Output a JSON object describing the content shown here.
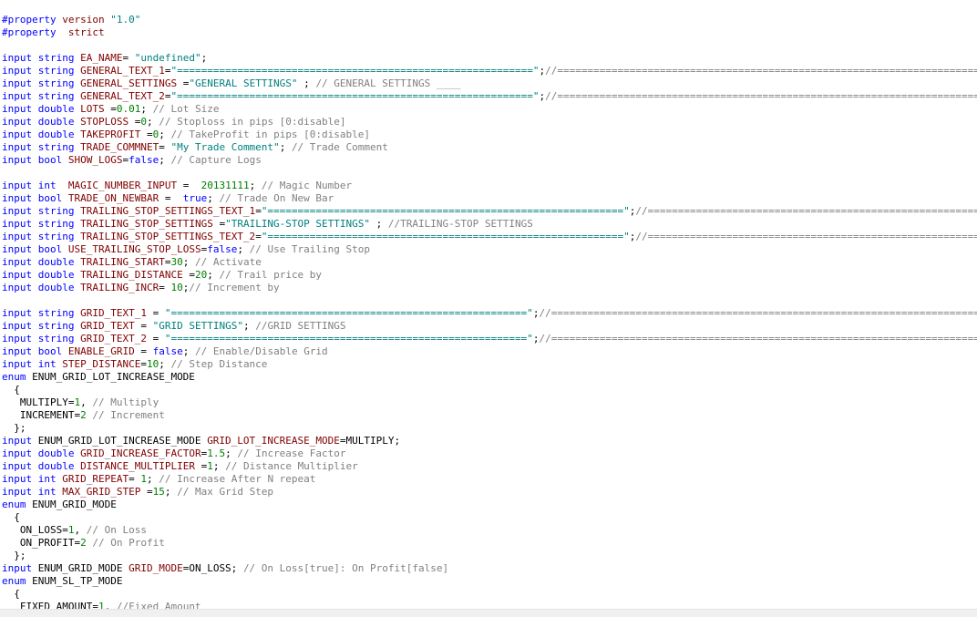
{
  "editor": {
    "lines": [
      [
        [
          "kw",
          "#property"
        ],
        [
          "pl",
          " "
        ],
        [
          "id",
          "version"
        ],
        [
          "pl",
          " "
        ],
        [
          "st",
          "\"1.0\""
        ]
      ],
      [
        [
          "kw",
          "#property"
        ],
        [
          "pl",
          "  "
        ],
        [
          "id",
          "strict"
        ]
      ],
      [],
      [
        [
          "kw",
          "input"
        ],
        [
          "pl",
          " "
        ],
        [
          "ty",
          "string"
        ],
        [
          "pl",
          " "
        ],
        [
          "id",
          "EA_NAME"
        ],
        [
          "pl",
          "= "
        ],
        [
          "st",
          "\"undefined\""
        ],
        [
          "pl",
          ";"
        ]
      ],
      [
        [
          "kw",
          "input"
        ],
        [
          "pl",
          " "
        ],
        [
          "ty",
          "string"
        ],
        [
          "pl",
          " "
        ],
        [
          "id",
          "GENERAL_TEXT_1"
        ],
        [
          "pl",
          "="
        ],
        [
          "st",
          "\"===========================================================\""
        ],
        [
          "pl",
          ";"
        ],
        [
          "cm",
          "//========================================================================"
        ]
      ],
      [
        [
          "kw",
          "input"
        ],
        [
          "pl",
          " "
        ],
        [
          "ty",
          "string"
        ],
        [
          "pl",
          " "
        ],
        [
          "id",
          "GENERAL_SETTINGS"
        ],
        [
          "pl",
          " ="
        ],
        [
          "st",
          "\"GENERAL SETTINGS\""
        ],
        [
          "pl",
          " ; "
        ],
        [
          "cm",
          "// GENERAL SETTINGS ____"
        ]
      ],
      [
        [
          "kw",
          "input"
        ],
        [
          "pl",
          " "
        ],
        [
          "ty",
          "string"
        ],
        [
          "pl",
          " "
        ],
        [
          "id",
          "GENERAL_TEXT_2"
        ],
        [
          "pl",
          "="
        ],
        [
          "st",
          "\"===========================================================\""
        ],
        [
          "pl",
          ";"
        ],
        [
          "cm",
          "//========================================================================"
        ]
      ],
      [
        [
          "kw",
          "input"
        ],
        [
          "pl",
          " "
        ],
        [
          "ty",
          "double"
        ],
        [
          "pl",
          " "
        ],
        [
          "id",
          "LOTS"
        ],
        [
          "pl",
          " ="
        ],
        [
          "nm",
          "0.01"
        ],
        [
          "pl",
          "; "
        ],
        [
          "cm",
          "// Lot Size"
        ]
      ],
      [
        [
          "kw",
          "input"
        ],
        [
          "pl",
          " "
        ],
        [
          "ty",
          "double"
        ],
        [
          "pl",
          " "
        ],
        [
          "id",
          "STOPLOSS"
        ],
        [
          "pl",
          " ="
        ],
        [
          "nm",
          "0"
        ],
        [
          "pl",
          "; "
        ],
        [
          "cm",
          "// Stoploss in pips [0:disable]"
        ]
      ],
      [
        [
          "kw",
          "input"
        ],
        [
          "pl",
          " "
        ],
        [
          "ty",
          "double"
        ],
        [
          "pl",
          " "
        ],
        [
          "id",
          "TAKEPROFIT"
        ],
        [
          "pl",
          " ="
        ],
        [
          "nm",
          "0"
        ],
        [
          "pl",
          "; "
        ],
        [
          "cm",
          "// TakeProfit in pips [0:disable]"
        ]
      ],
      [
        [
          "kw",
          "input"
        ],
        [
          "pl",
          " "
        ],
        [
          "ty",
          "string"
        ],
        [
          "pl",
          " "
        ],
        [
          "id",
          "TRADE_COMMNET"
        ],
        [
          "pl",
          "= "
        ],
        [
          "st",
          "\"My Trade Comment\""
        ],
        [
          "pl",
          "; "
        ],
        [
          "cm",
          "// Trade Comment"
        ]
      ],
      [
        [
          "kw",
          "input"
        ],
        [
          "pl",
          " "
        ],
        [
          "ty",
          "bool"
        ],
        [
          "pl",
          " "
        ],
        [
          "id",
          "SHOW_LOGS"
        ],
        [
          "pl",
          "="
        ],
        [
          "kw",
          "false"
        ],
        [
          "pl",
          "; "
        ],
        [
          "cm",
          "// Capture Logs"
        ]
      ],
      [],
      [
        [
          "kw",
          "input"
        ],
        [
          "pl",
          " "
        ],
        [
          "ty",
          "int"
        ],
        [
          "pl",
          "  "
        ],
        [
          "id",
          "MAGIC_NUMBER_INPUT"
        ],
        [
          "pl",
          " =  "
        ],
        [
          "nm",
          "20131111"
        ],
        [
          "pl",
          "; "
        ],
        [
          "cm",
          "// Magic Number"
        ]
      ],
      [
        [
          "kw",
          "input"
        ],
        [
          "pl",
          " "
        ],
        [
          "ty",
          "bool"
        ],
        [
          "pl",
          " "
        ],
        [
          "id",
          "TRADE_ON_NEWBAR"
        ],
        [
          "pl",
          " =  "
        ],
        [
          "kw",
          "true"
        ],
        [
          "pl",
          "; "
        ],
        [
          "cm",
          "// Trade On New Bar"
        ]
      ],
      [
        [
          "kw",
          "input"
        ],
        [
          "pl",
          " "
        ],
        [
          "ty",
          "string"
        ],
        [
          "pl",
          " "
        ],
        [
          "id",
          "TRAILING_STOP_SETTINGS_TEXT_1"
        ],
        [
          "pl",
          "="
        ],
        [
          "st",
          "\"===========================================================\""
        ],
        [
          "pl",
          ";"
        ],
        [
          "cm",
          "//=============================================================="
        ]
      ],
      [
        [
          "kw",
          "input"
        ],
        [
          "pl",
          " "
        ],
        [
          "ty",
          "string"
        ],
        [
          "pl",
          " "
        ],
        [
          "id",
          "TRAILING_STOP_SETTINGS"
        ],
        [
          "pl",
          " ="
        ],
        [
          "st",
          "\"TRAILING-STOP SETTINGS\""
        ],
        [
          "pl",
          " ; "
        ],
        [
          "cm",
          "//TRAILING-STOP SETTINGS"
        ]
      ],
      [
        [
          "kw",
          "input"
        ],
        [
          "pl",
          " "
        ],
        [
          "ty",
          "string"
        ],
        [
          "pl",
          " "
        ],
        [
          "id",
          "TRAILING_STOP_SETTINGS_TEXT_2"
        ],
        [
          "pl",
          "="
        ],
        [
          "st",
          "\"===========================================================\""
        ],
        [
          "pl",
          ";"
        ],
        [
          "cm",
          "//=============================================================="
        ]
      ],
      [
        [
          "kw",
          "input"
        ],
        [
          "pl",
          " "
        ],
        [
          "ty",
          "bool"
        ],
        [
          "pl",
          " "
        ],
        [
          "id",
          "USE_TRAILING_STOP_LOSS"
        ],
        [
          "pl",
          "="
        ],
        [
          "kw",
          "false"
        ],
        [
          "pl",
          "; "
        ],
        [
          "cm",
          "// Use Trailing Stop"
        ]
      ],
      [
        [
          "kw",
          "input"
        ],
        [
          "pl",
          " "
        ],
        [
          "ty",
          "double"
        ],
        [
          "pl",
          " "
        ],
        [
          "id",
          "TRAILING_START"
        ],
        [
          "pl",
          "="
        ],
        [
          "nm",
          "30"
        ],
        [
          "pl",
          "; "
        ],
        [
          "cm",
          "// Activate"
        ]
      ],
      [
        [
          "kw",
          "input"
        ],
        [
          "pl",
          " "
        ],
        [
          "ty",
          "double"
        ],
        [
          "pl",
          " "
        ],
        [
          "id",
          "TRAILING_DISTANCE"
        ],
        [
          "pl",
          " ="
        ],
        [
          "nm",
          "20"
        ],
        [
          "pl",
          "; "
        ],
        [
          "cm",
          "// Trail price by"
        ]
      ],
      [
        [
          "kw",
          "input"
        ],
        [
          "pl",
          " "
        ],
        [
          "ty",
          "double"
        ],
        [
          "pl",
          " "
        ],
        [
          "id",
          "TRAILING_INCR"
        ],
        [
          "pl",
          "= "
        ],
        [
          "nm",
          "10"
        ],
        [
          "pl",
          ";"
        ],
        [
          "cm",
          "// Increment by"
        ]
      ],
      [],
      [
        [
          "kw",
          "input"
        ],
        [
          "pl",
          " "
        ],
        [
          "ty",
          "string"
        ],
        [
          "pl",
          " "
        ],
        [
          "id",
          "GRID_TEXT_1"
        ],
        [
          "pl",
          " = "
        ],
        [
          "st",
          "\"===========================================================\""
        ],
        [
          "pl",
          ";"
        ],
        [
          "cm",
          "//========================================================================"
        ]
      ],
      [
        [
          "kw",
          "input"
        ],
        [
          "pl",
          " "
        ],
        [
          "ty",
          "string"
        ],
        [
          "pl",
          " "
        ],
        [
          "id",
          "GRID_TEXT"
        ],
        [
          "pl",
          " = "
        ],
        [
          "st",
          "\"GRID SETTINGS\""
        ],
        [
          "pl",
          "; "
        ],
        [
          "cm",
          "//GRID SETTINGS"
        ]
      ],
      [
        [
          "kw",
          "input"
        ],
        [
          "pl",
          " "
        ],
        [
          "ty",
          "string"
        ],
        [
          "pl",
          " "
        ],
        [
          "id",
          "GRID_TEXT_2"
        ],
        [
          "pl",
          " = "
        ],
        [
          "st",
          "\"===========================================================\""
        ],
        [
          "pl",
          ";"
        ],
        [
          "cm",
          "//========================================================================"
        ]
      ],
      [
        [
          "kw",
          "input"
        ],
        [
          "pl",
          " "
        ],
        [
          "ty",
          "bool"
        ],
        [
          "pl",
          " "
        ],
        [
          "id",
          "ENABLE_GRID"
        ],
        [
          "pl",
          " = "
        ],
        [
          "kw",
          "false"
        ],
        [
          "pl",
          "; "
        ],
        [
          "cm",
          "// Enable/Disable Grid"
        ]
      ],
      [
        [
          "kw",
          "input"
        ],
        [
          "pl",
          " "
        ],
        [
          "ty",
          "int"
        ],
        [
          "pl",
          " "
        ],
        [
          "id",
          "STEP_DISTANCE"
        ],
        [
          "pl",
          "="
        ],
        [
          "nm",
          "10"
        ],
        [
          "pl",
          "; "
        ],
        [
          "cm",
          "// Step Distance"
        ]
      ],
      [
        [
          "kw",
          "enum"
        ],
        [
          "pl",
          " ENUM_GRID_LOT_INCREASE_MODE"
        ]
      ],
      [
        [
          "pl",
          "  {"
        ]
      ],
      [
        [
          "pl",
          "   MULTIPLY="
        ],
        [
          "nm",
          "1"
        ],
        [
          "pl",
          ", "
        ],
        [
          "cm",
          "// Multiply"
        ]
      ],
      [
        [
          "pl",
          "   INCREMENT="
        ],
        [
          "nm",
          "2"
        ],
        [
          "pl",
          " "
        ],
        [
          "cm",
          "// Increment"
        ]
      ],
      [
        [
          "pl",
          "  };"
        ]
      ],
      [
        [
          "kw",
          "input"
        ],
        [
          "pl",
          " ENUM_GRID_LOT_INCREASE_MODE "
        ],
        [
          "id",
          "GRID_LOT_INCREASE_MODE"
        ],
        [
          "pl",
          "=MULTIPLY;"
        ]
      ],
      [
        [
          "kw",
          "input"
        ],
        [
          "pl",
          " "
        ],
        [
          "ty",
          "double"
        ],
        [
          "pl",
          " "
        ],
        [
          "id",
          "GRID_INCREASE_FACTOR"
        ],
        [
          "pl",
          "="
        ],
        [
          "nm",
          "1.5"
        ],
        [
          "pl",
          "; "
        ],
        [
          "cm",
          "// Increase Factor"
        ]
      ],
      [
        [
          "kw",
          "input"
        ],
        [
          "pl",
          " "
        ],
        [
          "ty",
          "double"
        ],
        [
          "pl",
          " "
        ],
        [
          "id",
          "DISTANCE_MULTIPLIER"
        ],
        [
          "pl",
          " ="
        ],
        [
          "nm",
          "1"
        ],
        [
          "pl",
          "; "
        ],
        [
          "cm",
          "// Distance Multiplier"
        ]
      ],
      [
        [
          "kw",
          "input"
        ],
        [
          "pl",
          " "
        ],
        [
          "ty",
          "int"
        ],
        [
          "pl",
          " "
        ],
        [
          "id",
          "GRID_REPEAT"
        ],
        [
          "pl",
          "= "
        ],
        [
          "nm",
          "1"
        ],
        [
          "pl",
          "; "
        ],
        [
          "cm",
          "// Increase After N repeat"
        ]
      ],
      [
        [
          "kw",
          "input"
        ],
        [
          "pl",
          " "
        ],
        [
          "ty",
          "int"
        ],
        [
          "pl",
          " "
        ],
        [
          "id",
          "MAX_GRID_STEP"
        ],
        [
          "pl",
          " ="
        ],
        [
          "nm",
          "15"
        ],
        [
          "pl",
          "; "
        ],
        [
          "cm",
          "// Max Grid Step"
        ]
      ],
      [
        [
          "kw",
          "enum"
        ],
        [
          "pl",
          " ENUM_GRID_MODE"
        ]
      ],
      [
        [
          "pl",
          "  {"
        ]
      ],
      [
        [
          "pl",
          "   ON_LOSS="
        ],
        [
          "nm",
          "1"
        ],
        [
          "pl",
          ", "
        ],
        [
          "cm",
          "// On Loss"
        ]
      ],
      [
        [
          "pl",
          "   ON_PROFIT="
        ],
        [
          "nm",
          "2"
        ],
        [
          "pl",
          " "
        ],
        [
          "cm",
          "// On Profit"
        ]
      ],
      [
        [
          "pl",
          "  };"
        ]
      ],
      [
        [
          "kw",
          "input"
        ],
        [
          "pl",
          " ENUM_GRID_MODE "
        ],
        [
          "id",
          "GRID_MODE"
        ],
        [
          "pl",
          "=ON_LOSS; "
        ],
        [
          "cm",
          "// On Loss[true]: On Profit[false]"
        ]
      ],
      [
        [
          "kw",
          "enum"
        ],
        [
          "pl",
          " ENUM_SL_TP_MODE"
        ]
      ],
      [
        [
          "pl",
          "  {"
        ]
      ],
      [
        [
          "pl",
          "   FIXED_AMOUNT="
        ],
        [
          "nm",
          "1"
        ],
        [
          "pl",
          ", "
        ],
        [
          "cm",
          "//Fixed Amount"
        ]
      ]
    ]
  },
  "colors": {
    "keyword": "#0000ff",
    "identifier": "#800000",
    "string": "#008080",
    "number": "#008000",
    "comment": "#808080",
    "plain": "#000000"
  }
}
